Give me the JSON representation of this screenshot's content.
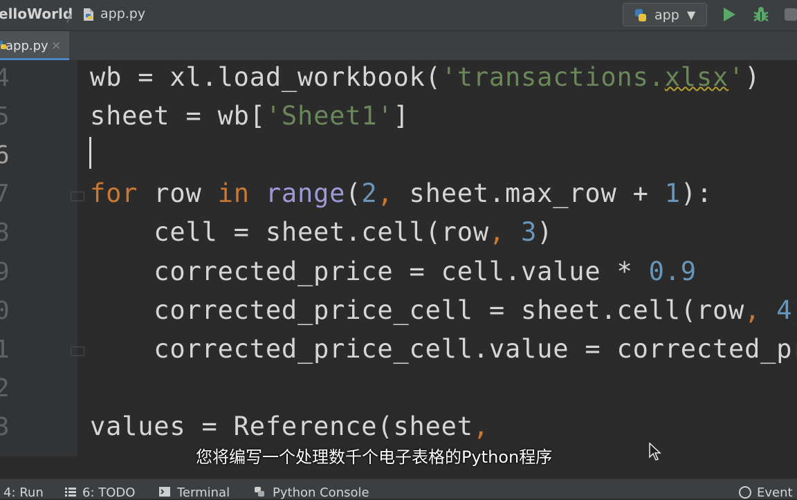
{
  "navbar": {
    "project": "elloWorld",
    "separator": "〉",
    "file": "app.py",
    "run_config": "app"
  },
  "tabs": [
    {
      "label": "app.py",
      "close": "×"
    }
  ],
  "editor": {
    "line_numbers": [
      "4",
      "5",
      "6",
      "7",
      "8",
      "9",
      "0",
      "1",
      "2",
      "3"
    ]
  },
  "subtitle": "您将编写一个处理数千个电子表格的Python程序",
  "bottom_bar": {
    "run": "4: Run",
    "todo": "6: TODO",
    "terminal": "Terminal",
    "python_console": "Python Console",
    "event_log": "Event L"
  },
  "colors": {
    "keyword": "#cc7832",
    "builtin": "#9e9ad8",
    "number": "#6897bb",
    "string": "#6a8759",
    "accent": "#4a88c7",
    "run_green": "#59a869"
  }
}
